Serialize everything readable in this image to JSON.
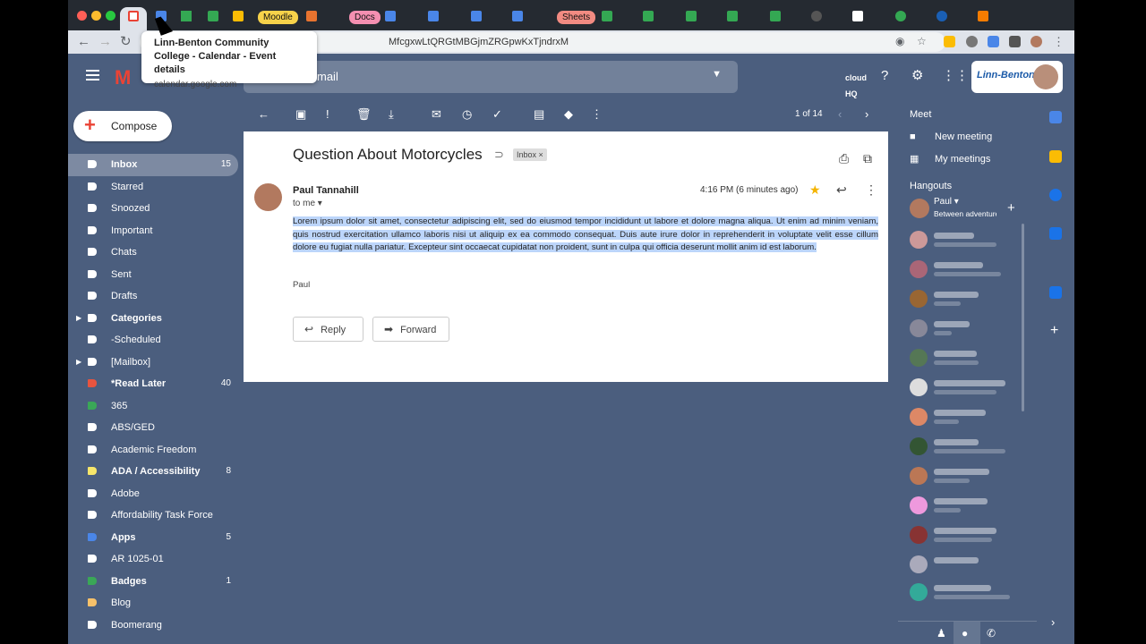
{
  "browser": {
    "url": "MfcgxwLtQRGtMBGjmZRGpwKxTjndrxM",
    "tooltip": {
      "title": "Linn-Benton Community College - Calendar - Event details",
      "domain": "calendar.google.com"
    },
    "tab_labels": {
      "moodle": "Moodle",
      "docs": "Docs",
      "sheets": "Sheets"
    }
  },
  "header": {
    "search_placeholder": "mail",
    "account_org": "Linn-Benton",
    "icons": [
      "menu-icon",
      "gmail-logo",
      "dropdown-icon",
      "cloudhq-icon",
      "help-icon",
      "settings-icon",
      "apps-icon",
      "avatar"
    ]
  },
  "sidebar": {
    "compose_label": "Compose",
    "items": [
      {
        "label": "Inbox",
        "count": "15",
        "bold": true,
        "active": true,
        "icon": "inbox-icon",
        "color": "#ffffff"
      },
      {
        "label": "Starred",
        "count": "",
        "icon": "star-icon",
        "color": "#ffffff"
      },
      {
        "label": "Snoozed",
        "count": "",
        "icon": "clock-icon",
        "color": "#ffffff"
      },
      {
        "label": "Important",
        "count": "",
        "icon": "important-icon",
        "color": "#ffffff"
      },
      {
        "label": "Chats",
        "count": "",
        "icon": "chat-icon",
        "color": "#ffffff"
      },
      {
        "label": "Sent",
        "count": "",
        "icon": "send-icon",
        "color": "#ffffff"
      },
      {
        "label": "Drafts",
        "count": "",
        "icon": "draft-icon",
        "color": "#ffffff"
      },
      {
        "label": "Categories",
        "count": "",
        "bold": true,
        "expand": true,
        "icon": "label-icon",
        "color": "#ffffff"
      },
      {
        "label": "-Scheduled",
        "count": "",
        "icon": "label-icon",
        "color": "#ffffff"
      },
      {
        "label": "[Mailbox]",
        "count": "",
        "expand": true,
        "icon": "label-icon",
        "color": "#ffffff"
      },
      {
        "label": "*Read Later",
        "count": "40",
        "bold": true,
        "icon": "label-icon",
        "color": "#e8543f"
      },
      {
        "label": "365",
        "count": "",
        "icon": "label-icon",
        "color": "#3aa757"
      },
      {
        "label": "ABS/GED",
        "count": "",
        "icon": "label-icon",
        "color": "#ffffff"
      },
      {
        "label": "Academic Freedom",
        "count": "",
        "icon": "label-icon",
        "color": "#ffffff"
      },
      {
        "label": "ADA / Accessibility",
        "count": "8",
        "bold": true,
        "icon": "label-icon",
        "color": "#f7e66a"
      },
      {
        "label": "Adobe",
        "count": "",
        "icon": "label-icon",
        "color": "#ffffff"
      },
      {
        "label": "Affordability Task Force",
        "count": "",
        "icon": "label-icon",
        "color": "#ffffff"
      },
      {
        "label": "Apps",
        "count": "5",
        "bold": true,
        "icon": "label-icon",
        "color": "#4a86e8"
      },
      {
        "label": "AR 1025-01",
        "count": "",
        "icon": "label-icon",
        "color": "#ffffff"
      },
      {
        "label": "Badges",
        "count": "1",
        "bold": true,
        "icon": "label-icon",
        "color": "#3aa757"
      },
      {
        "label": "Blog",
        "count": "",
        "icon": "label-icon",
        "color": "#f7c16a"
      },
      {
        "label": "Boomerang",
        "count": "",
        "icon": "label-icon",
        "color": "#ffffff"
      }
    ]
  },
  "toolbar": {
    "pagination": "1 of 14",
    "icons": [
      "back-icon",
      "archive-icon",
      "report-spam-icon",
      "delete-icon",
      "download-icon",
      "mark-unread-icon",
      "snooze-icon",
      "add-task-icon",
      "move-to-icon",
      "labels-icon",
      "more-icon",
      "prev-icon",
      "next-icon"
    ]
  },
  "message": {
    "subject": "Question About Motorcycles",
    "label_badge": "Inbox ×",
    "sender": "Paul Tannahill",
    "to": "to me ▾",
    "time": "4:16 PM (6 minutes ago)",
    "body": "Lorem ipsum dolor sit amet, consectetur adipiscing elit, sed do eiusmod tempor incididunt ut labore et dolore magna aliqua. Ut enim ad minim veniam, quis nostrud exercitation ullamco laboris nisi ut aliquip ex ea commodo consequat. Duis aute irure dolor in reprehenderit in voluptate velit esse cillum dolore eu fugiat nulla pariatur. Excepteur sint occaecat cupidatat non proident, sunt in culpa qui officia deserunt mollit anim id est laborum.",
    "signature": "Paul",
    "reply_label": "Reply",
    "forward_label": "Forward"
  },
  "right_panel": {
    "meet_title": "Meet",
    "new_meeting": "New meeting",
    "my_meetings": "My meetings",
    "hangouts_title": "Hangouts",
    "me_name": "Paul ▾",
    "me_status": "Between adventures"
  }
}
